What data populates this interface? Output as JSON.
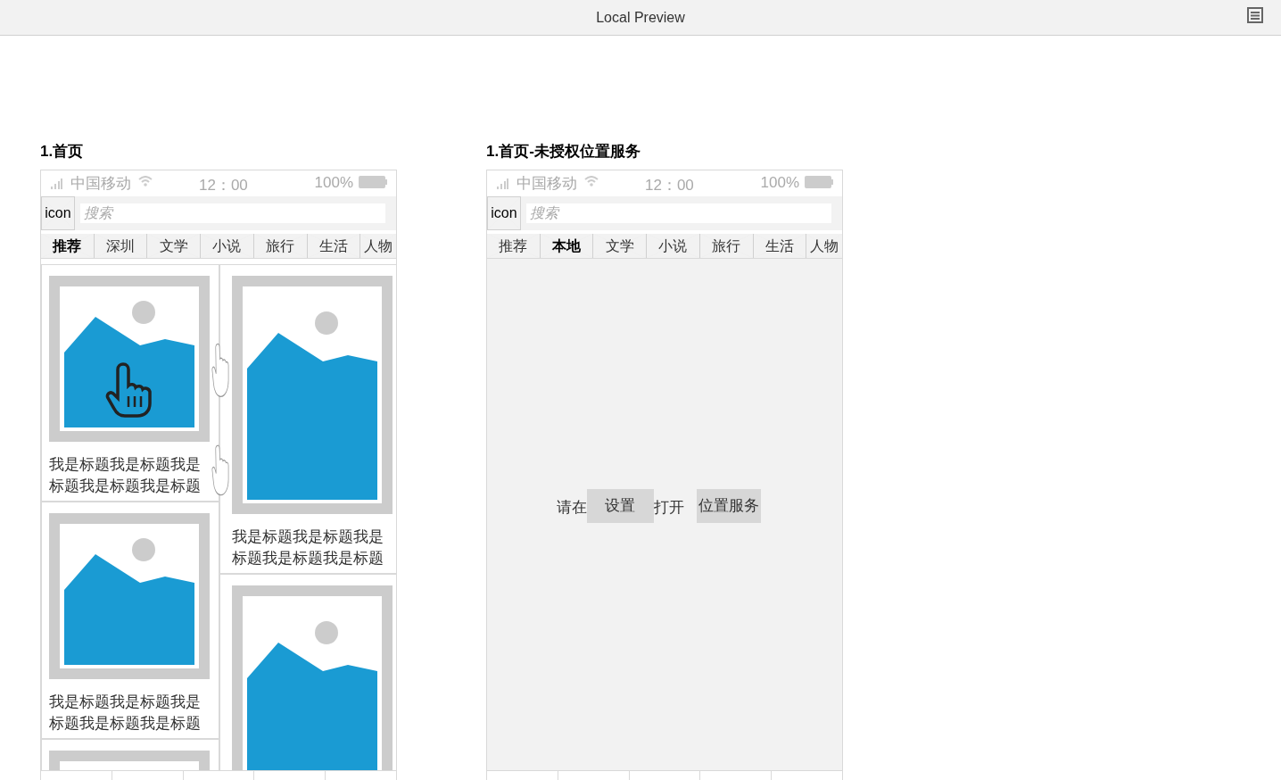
{
  "window": {
    "title": "Local Preview"
  },
  "screens": [
    {
      "heading": "1.首页",
      "kind": "feed",
      "status_bar": {
        "carrier": "中国移动",
        "time": "12：00",
        "battery": "100%"
      },
      "search": {
        "icon_label": "icon",
        "placeholder": "搜索"
      },
      "tabs": [
        {
          "label": "推荐",
          "selected": true
        },
        {
          "label": "深圳",
          "selected": false
        },
        {
          "label": "文学",
          "selected": false
        },
        {
          "label": "小说",
          "selected": false
        },
        {
          "label": "旅行",
          "selected": false
        },
        {
          "label": "生活",
          "selected": false
        },
        {
          "label": "人物",
          "selected": false
        }
      ],
      "feed": {
        "left": [
          {
            "kind": "image_card",
            "title": "我是标题我是标题我是标题我是标题我是标题"
          },
          {
            "kind": "image_card",
            "title": "我是标题我是标题我是标题我是标题我是标题"
          },
          {
            "kind": "image_card"
          }
        ],
        "right": [
          {
            "kind": "image_card",
            "title": "我是标题我是标题我是标题我是标题我是标题"
          },
          {
            "kind": "image_card"
          }
        ]
      }
    },
    {
      "heading": "1.首页-未授权位置服务",
      "kind": "notice",
      "status_bar": {
        "carrier": "中国移动",
        "time": "12：00",
        "battery": "100%"
      },
      "search": {
        "icon_label": "icon",
        "placeholder": "搜索"
      },
      "tabs": [
        {
          "label": "推荐",
          "selected": false
        },
        {
          "label": "本地",
          "selected": true
        },
        {
          "label": "文学",
          "selected": false
        },
        {
          "label": "小说",
          "selected": false
        },
        {
          "label": "旅行",
          "selected": false
        },
        {
          "label": "生活",
          "selected": false
        },
        {
          "label": "人物",
          "selected": false
        }
      ],
      "message": [
        {
          "kind": "text",
          "text": "请在"
        },
        {
          "kind": "button",
          "text": "设置"
        },
        {
          "kind": "text",
          "text": "打开"
        },
        {
          "kind": "button",
          "text": "位置服务"
        }
      ]
    }
  ]
}
